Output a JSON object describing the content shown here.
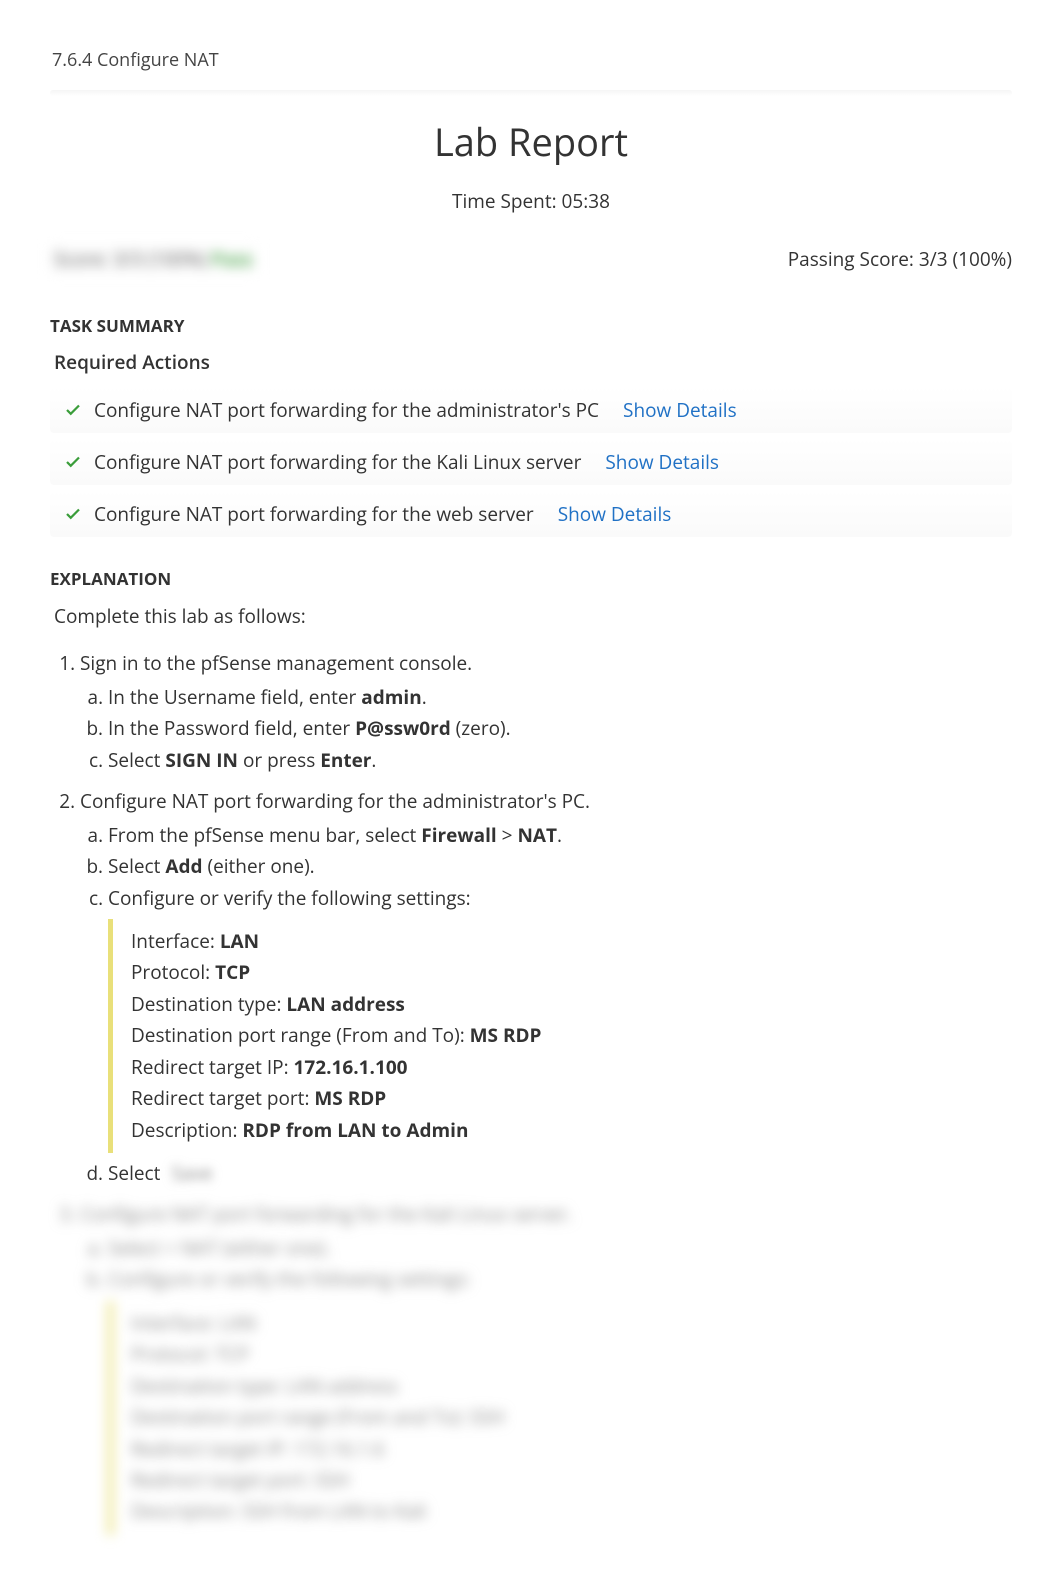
{
  "breadcrumb": "7.6.4 Configure NAT",
  "report_title": "Lab Report",
  "time_spent_label": "Time Spent: 05:38",
  "score_left_hidden": "Score: 3/3 (100%) ",
  "score_left_pass": "Pass",
  "passing_score": "Passing Score: 3/3 (100%)",
  "task_summary_heading": "TASK SUMMARY",
  "required_actions_heading": "Required Actions",
  "tasks": [
    {
      "text": "Configure NAT port forwarding for the administrator's PC",
      "link": "Show Details"
    },
    {
      "text": "Configure NAT port forwarding for the Kali Linux server",
      "link": "Show Details"
    },
    {
      "text": "Configure NAT port forwarding for the web server",
      "link": "Show Details"
    }
  ],
  "explanation_heading": "EXPLANATION",
  "explanation_intro": "Complete this lab as follows:",
  "steps": {
    "s1": {
      "text": "Sign in to the pfSense management console.",
      "a_pre": "In the Username field, enter ",
      "a_b": "admin",
      "a_post": ".",
      "b_pre": "In the Password field, enter ",
      "b_b": "P@ssw0rd",
      "b_post": " (zero).",
      "c_pre": "Select ",
      "c_b1": "SIGN IN",
      "c_mid": " or press ",
      "c_b2": "Enter",
      "c_post": "."
    },
    "s2": {
      "text": "Configure NAT port forwarding for the administrator's PC.",
      "a_pre": "From the pfSense menu bar, select ",
      "a_b1": "Firewall",
      "a_mid": " > ",
      "a_b2": "NAT",
      "a_post": ".",
      "b_pre": "Select ",
      "b_b": "Add",
      "b_post": " (either one).",
      "c_text": "Configure or verify the following settings:",
      "settings": {
        "iface_l": "Interface: ",
        "iface_v": "LAN",
        "proto_l": "Protocol: ",
        "proto_v": "TCP",
        "dtype_l": "Destination type: ",
        "dtype_v": "LAN address",
        "dport_l": "Destination port range (From and To): ",
        "dport_v": "MS RDP",
        "rip_l": "Redirect target IP: ",
        "rip_v": "172.16.1.100",
        "rport_l": "Redirect target port: ",
        "rport_v": "MS RDP",
        "desc_l": "Description: ",
        "desc_v": "RDP from LAN to Admin"
      },
      "d_pre": "Select ",
      "d_hidden": "Save"
    },
    "hidden3": {
      "title": "Configure NAT port forwarding for the Kali Linux server.",
      "a": "Select + NAT (either one).",
      "b": "Configure or verify the following settings:",
      "iface": "Interface:    LAN",
      "proto": "Protocol:    TCP",
      "dtype": "Destination type:       LAN address",
      "dport": "Destination port range (From and To):          SSH",
      "rip": "Redirect target IP:       172.16.1.6",
      "rport": "Redirect target port:      SSH",
      "desc": "Description:     SSH from LAN to Kali"
    }
  }
}
